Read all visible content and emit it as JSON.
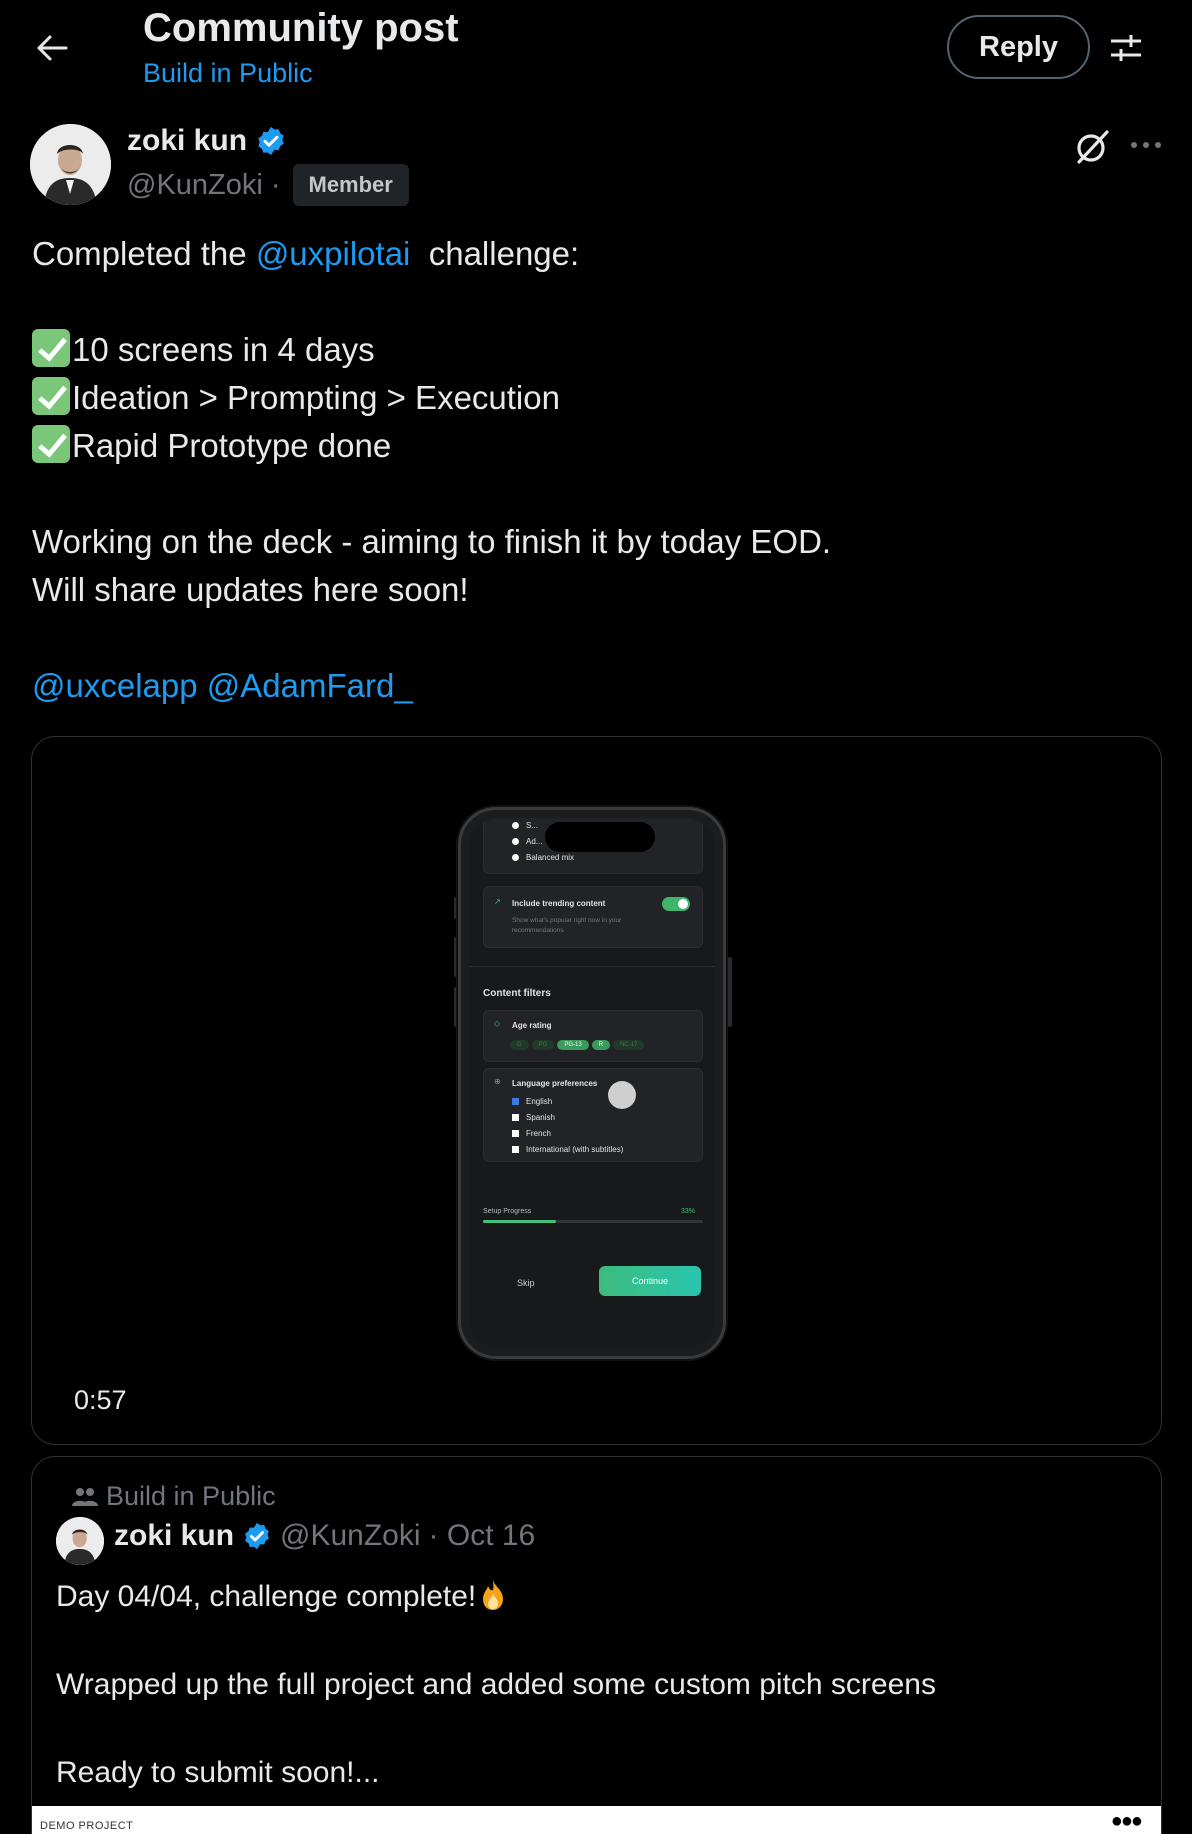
{
  "header": {
    "title": "Community post",
    "subtitle": "Build in Public",
    "reply_label": "Reply"
  },
  "post": {
    "author_name": "zoki kun",
    "handle": "@KunZoki",
    "separator": "·",
    "badge": "Member",
    "line1_prefix": "Completed the ",
    "line1_mention": "@uxpilotai",
    "line1_suffix": "  challenge:",
    "checklist": [
      "10 screens in 4 days",
      "Ideation > Prompting > Execution",
      "Rapid Prototype done"
    ],
    "line_deck1": "Working on the deck - aiming to finish it by today EOD.",
    "line_deck2": "Will share updates here soon!",
    "mentions": "@uxcelapp @AdamFard_"
  },
  "video": {
    "duration": "0:57",
    "app": {
      "row_top1": "S...",
      "row_top2": "Ad...",
      "balanced": "Balanced mix",
      "trending_title": "Include trending content",
      "trending_desc1": "Show what's popular right now in your",
      "trending_desc2": "recommendations",
      "filters_title": "Content filters",
      "age_title": "Age rating",
      "age_chips": [
        "G",
        "PG",
        "PG-13",
        "R",
        "NC-17"
      ],
      "lang_title": "Language preferences",
      "languages": [
        "English",
        "Spanish",
        "French",
        "International (with subtitles)"
      ],
      "progress_label": "Setup Progress",
      "progress_value": "33%",
      "progress_fraction": 0.33,
      "skip": "Skip",
      "continue": "Continue"
    }
  },
  "quote": {
    "community": "Build in Public",
    "author_name": "zoki kun",
    "handle": "@KunZoki",
    "date": "· Oct 16",
    "line1": "Day 04/04, challenge complete!",
    "line2": "Wrapped up the full project and added some custom pitch screens",
    "line3": "Ready to submit soon!...",
    "image_label": "DEMO PROJECT"
  },
  "colors": {
    "accent": "#1d9bf0",
    "background": "#000000",
    "text": "#e7e9ea",
    "muted": "#71767b",
    "verified": "#1d9bf0"
  }
}
